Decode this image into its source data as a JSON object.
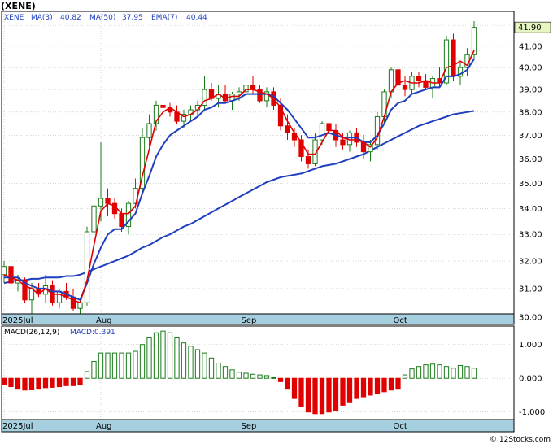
{
  "ticker_title": "(XENE)",
  "watermark": "© 12Stocks.com",
  "colors": {
    "up": "#1a7a1a",
    "down": "#e00000",
    "ma3": "#e00000",
    "ma50": "#1f3fbf",
    "ema7": "#1f3fbf",
    "date_band": "#a6cfe0",
    "grid": "#bdbdbd",
    "price_tag_bg": "#e6f6c2"
  },
  "legend": {
    "ticker": "XENE",
    "ma3_label": "MA(3)",
    "ma3_value": "40.82",
    "ma50_label": "MA(50)",
    "ma50_value": "37.95",
    "ema7_label": "EMA(7)",
    "ema7_value": "40.44"
  },
  "macd_legend": {
    "label": "MACD(26,12,9)",
    "value_label": "MACD:0.391"
  },
  "last_price": "41.90",
  "chart_data": [
    {
      "type": "candlestick",
      "title": "(XENE)",
      "y_scale": "log",
      "ylim": [
        29.8,
        42.6
      ],
      "y_ticks": [
        "30.00",
        "31.00",
        "32.00",
        "33.00",
        "34.00",
        "35.00",
        "36.00",
        "37.00",
        "38.00",
        "39.00",
        "40.00",
        "41.00",
        "42.00"
      ],
      "x_labels": [
        {
          "label": "2025Jul",
          "bar": 0
        },
        {
          "label": "Aug",
          "bar": 14
        },
        {
          "label": "Sep",
          "bar": 35
        },
        {
          "label": "Oct",
          "bar": 57
        }
      ],
      "ohlc": [
        [
          31.5,
          32.0,
          31.2,
          31.8
        ],
        [
          31.8,
          31.9,
          31.0,
          31.2
        ],
        [
          31.2,
          31.5,
          30.9,
          31.3
        ],
        [
          31.3,
          31.4,
          30.5,
          30.6
        ],
        [
          30.6,
          31.2,
          30.1,
          31.0
        ],
        [
          31.0,
          31.2,
          30.7,
          30.8
        ],
        [
          30.8,
          31.5,
          30.5,
          31.1
        ],
        [
          31.1,
          31.3,
          30.4,
          30.5
        ],
        [
          30.5,
          31.0,
          30.3,
          30.9
        ],
        [
          30.9,
          31.2,
          30.6,
          30.7
        ],
        [
          30.7,
          31.0,
          30.2,
          30.3
        ],
        [
          30.3,
          30.6,
          30.0,
          30.5
        ],
        [
          30.5,
          33.3,
          30.4,
          33.1
        ],
        [
          33.1,
          34.5,
          32.9,
          34.1
        ],
        [
          34.1,
          36.7,
          33.5,
          34.4
        ],
        [
          34.4,
          34.8,
          33.7,
          34.2
        ],
        [
          34.2,
          34.4,
          33.6,
          33.8
        ],
        [
          33.8,
          34.0,
          33.1,
          33.3
        ],
        [
          33.3,
          34.3,
          33.0,
          34.2
        ],
        [
          34.2,
          35.2,
          34.0,
          34.8
        ],
        [
          34.8,
          37.3,
          34.7,
          36.9
        ],
        [
          36.9,
          37.9,
          36.5,
          37.5
        ],
        [
          37.5,
          38.5,
          37.2,
          38.3
        ],
        [
          38.3,
          38.5,
          37.8,
          38.2
        ],
        [
          38.2,
          38.4,
          37.8,
          38.0
        ],
        [
          38.0,
          38.3,
          37.5,
          37.6
        ],
        [
          37.6,
          38.1,
          37.3,
          37.9
        ],
        [
          37.9,
          38.3,
          37.6,
          38.1
        ],
        [
          38.1,
          38.5,
          37.8,
          38.3
        ],
        [
          38.3,
          39.6,
          38.1,
          39.0
        ],
        [
          39.0,
          39.3,
          38.5,
          38.6
        ],
        [
          38.6,
          39.2,
          38.2,
          38.8
        ],
        [
          38.8,
          39.2,
          38.4,
          38.5
        ],
        [
          38.5,
          38.9,
          38.1,
          38.8
        ],
        [
          38.8,
          39.1,
          38.5,
          38.9
        ],
        [
          38.9,
          39.5,
          38.7,
          39.2
        ],
        [
          39.2,
          39.6,
          38.8,
          39.0
        ],
        [
          39.0,
          39.2,
          38.4,
          38.5
        ],
        [
          38.5,
          39.1,
          38.2,
          38.9
        ],
        [
          38.9,
          39.1,
          38.1,
          38.3
        ],
        [
          38.3,
          38.6,
          37.2,
          37.4
        ],
        [
          37.4,
          37.9,
          36.8,
          37.1
        ],
        [
          37.1,
          37.3,
          36.5,
          36.8
        ],
        [
          36.8,
          37.0,
          35.9,
          36.1
        ],
        [
          36.1,
          36.4,
          35.6,
          35.8
        ],
        [
          35.8,
          37.1,
          35.7,
          36.8
        ],
        [
          36.8,
          37.6,
          36.6,
          37.5
        ],
        [
          37.5,
          38.0,
          37.0,
          37.2
        ],
        [
          37.2,
          37.5,
          36.5,
          36.8
        ],
        [
          36.8,
          37.1,
          36.4,
          36.6
        ],
        [
          36.6,
          37.2,
          36.3,
          37.1
        ],
        [
          37.1,
          37.3,
          36.5,
          36.7
        ],
        [
          36.7,
          37.0,
          36.0,
          36.3
        ],
        [
          36.3,
          36.8,
          35.9,
          36.6
        ],
        [
          36.6,
          38.0,
          36.4,
          37.8
        ],
        [
          37.8,
          39.0,
          37.5,
          38.9
        ],
        [
          38.9,
          40.0,
          38.6,
          39.9
        ],
        [
          39.9,
          40.3,
          39.0,
          39.2
        ],
        [
          39.2,
          39.6,
          38.7,
          39.0
        ],
        [
          39.0,
          39.8,
          38.8,
          39.6
        ],
        [
          39.6,
          39.8,
          39.1,
          39.4
        ],
        [
          39.4,
          39.7,
          39.0,
          39.1
        ],
        [
          39.1,
          39.6,
          38.6,
          39.5
        ],
        [
          39.5,
          40.0,
          39.1,
          39.3
        ],
        [
          39.3,
          41.5,
          39.2,
          41.3
        ],
        [
          41.3,
          41.6,
          39.4,
          39.6
        ],
        [
          39.6,
          40.2,
          39.2,
          40.0
        ],
        [
          40.0,
          40.9,
          39.6,
          40.6
        ],
        [
          40.6,
          42.2,
          40.4,
          41.9
        ]
      ],
      "series": [
        {
          "name": "MA(3)",
          "values": [
            31.5,
            31.4,
            31.3,
            31.1,
            31.0,
            30.8,
            31.0,
            30.8,
            30.8,
            30.7,
            30.6,
            30.5,
            31.3,
            32.6,
            33.9,
            34.2,
            34.1,
            33.8,
            33.8,
            34.1,
            35.3,
            36.4,
            37.6,
            38.0,
            38.2,
            38.0,
            37.8,
            37.9,
            38.1,
            38.5,
            38.6,
            38.8,
            38.6,
            38.7,
            38.7,
            39.0,
            39.0,
            38.9,
            38.8,
            38.6,
            38.2,
            37.6,
            37.1,
            36.7,
            36.2,
            36.2,
            36.7,
            37.2,
            37.2,
            36.9,
            36.8,
            36.8,
            36.7,
            36.5,
            36.9,
            37.8,
            38.9,
            39.3,
            39.4,
            39.3,
            39.3,
            39.4,
            39.3,
            39.3,
            40.0,
            40.1,
            40.3,
            40.1,
            40.8
          ]
        },
        {
          "name": "EMA(7)",
          "values": [
            31.4,
            31.4,
            31.4,
            31.2,
            31.1,
            31.0,
            31.0,
            30.9,
            30.9,
            30.8,
            30.7,
            30.6,
            31.2,
            31.9,
            32.5,
            33.0,
            33.2,
            33.2,
            33.5,
            33.8,
            34.6,
            35.3,
            36.1,
            36.6,
            37.0,
            37.2,
            37.4,
            37.6,
            37.8,
            38.1,
            38.2,
            38.4,
            38.4,
            38.5,
            38.6,
            38.8,
            38.8,
            38.8,
            38.8,
            38.7,
            38.4,
            38.1,
            37.7,
            37.3,
            36.9,
            36.9,
            37.0,
            37.1,
            37.0,
            36.9,
            36.9,
            36.9,
            36.7,
            36.7,
            37.0,
            37.5,
            38.1,
            38.4,
            38.5,
            38.8,
            38.9,
            39.0,
            39.1,
            39.1,
            39.6,
            39.6,
            39.7,
            39.9,
            40.4
          ]
        },
        {
          "name": "MA(50)",
          "values": [
            31.2,
            31.25,
            31.3,
            31.3,
            31.35,
            31.35,
            31.4,
            31.4,
            31.4,
            31.45,
            31.45,
            31.5,
            31.6,
            31.7,
            31.8,
            31.9,
            32.0,
            32.1,
            32.2,
            32.35,
            32.5,
            32.6,
            32.75,
            32.9,
            33.0,
            33.15,
            33.3,
            33.4,
            33.55,
            33.7,
            33.85,
            34.0,
            34.15,
            34.3,
            34.45,
            34.6,
            34.75,
            34.9,
            35.05,
            35.15,
            35.25,
            35.3,
            35.35,
            35.4,
            35.5,
            35.6,
            35.7,
            35.75,
            35.8,
            35.9,
            36.0,
            36.1,
            36.2,
            36.35,
            36.5,
            36.65,
            36.8,
            36.95,
            37.1,
            37.25,
            37.4,
            37.5,
            37.6,
            37.7,
            37.8,
            37.9,
            37.95,
            38.0,
            38.05
          ]
        }
      ]
    },
    {
      "type": "bar",
      "title": "MACD(26,12,9)",
      "ylim": [
        -1.2,
        1.5
      ],
      "y_ticks": [
        "-1.000",
        "0.000",
        "1.000"
      ],
      "x_labels": [
        {
          "label": "2025Jul",
          "bar": 0
        },
        {
          "label": "Aug",
          "bar": 14
        },
        {
          "label": "Sep",
          "bar": 35
        },
        {
          "label": "Oct",
          "bar": 57
        }
      ],
      "values": [
        -0.2,
        -0.25,
        -0.3,
        -0.35,
        -0.32,
        -0.3,
        -0.28,
        -0.27,
        -0.25,
        -0.22,
        -0.22,
        -0.2,
        0.2,
        0.5,
        0.75,
        0.75,
        0.75,
        0.75,
        0.75,
        0.8,
        1.0,
        1.2,
        1.35,
        1.4,
        1.35,
        1.2,
        1.05,
        0.95,
        0.85,
        0.75,
        0.6,
        0.45,
        0.35,
        0.25,
        0.18,
        0.15,
        0.12,
        0.1,
        0.08,
        0.02,
        -0.1,
        -0.3,
        -0.6,
        -0.85,
        -1.0,
        -1.05,
        -1.05,
        -1.0,
        -0.95,
        -0.8,
        -0.7,
        -0.6,
        -0.55,
        -0.5,
        -0.45,
        -0.4,
        -0.35,
        -0.3,
        0.1,
        0.28,
        0.35,
        0.4,
        0.42,
        0.4,
        0.35,
        0.3,
        0.38,
        0.35,
        0.3,
        0.32,
        0.39
      ]
    }
  ]
}
